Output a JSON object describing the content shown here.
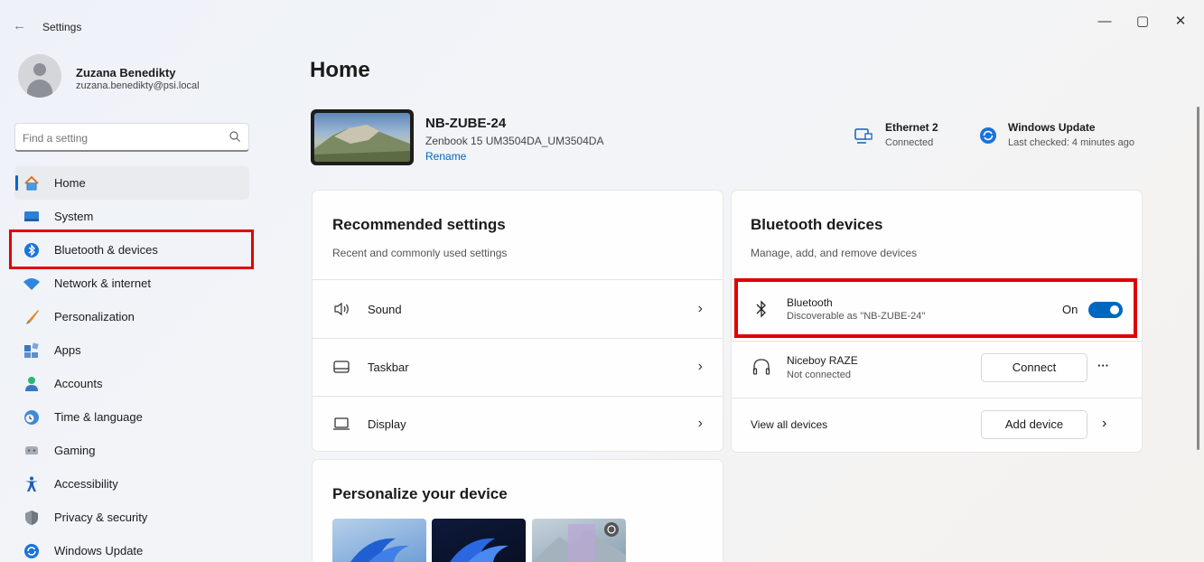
{
  "window": {
    "title": "Settings",
    "back_glyph": "←",
    "minimize_glyph": "—",
    "maximize_glyph": "▢",
    "close_glyph": "✕"
  },
  "profile": {
    "name": "Zuzana Benedikty",
    "email": "zuzana.benedikty@psi.local"
  },
  "search": {
    "placeholder": "Find a setting"
  },
  "nav": {
    "items": [
      {
        "label": "Home",
        "icon": "home-icon"
      },
      {
        "label": "System",
        "icon": "system-icon"
      },
      {
        "label": "Bluetooth & devices",
        "icon": "bluetooth-icon"
      },
      {
        "label": "Network & internet",
        "icon": "wifi-icon"
      },
      {
        "label": "Personalization",
        "icon": "brush-icon"
      },
      {
        "label": "Apps",
        "icon": "apps-icon"
      },
      {
        "label": "Accounts",
        "icon": "account-icon"
      },
      {
        "label": "Time & language",
        "icon": "clock-globe-icon"
      },
      {
        "label": "Gaming",
        "icon": "gamepad-icon"
      },
      {
        "label": "Accessibility",
        "icon": "accessibility-icon"
      },
      {
        "label": "Privacy & security",
        "icon": "shield-icon"
      },
      {
        "label": "Windows Update",
        "icon": "update-icon"
      }
    ]
  },
  "main": {
    "title": "Home",
    "device": {
      "name": "NB-ZUBE-24",
      "model": "Zenbook 15 UM3504DA_UM3504DA",
      "rename": "Rename"
    },
    "status": {
      "ethernet_title": "Ethernet 2",
      "ethernet_sub": "Connected",
      "update_title": "Windows Update",
      "update_sub": "Last checked: 4 minutes ago"
    },
    "recommended": {
      "title": "Recommended settings",
      "subtitle": "Recent and commonly used settings",
      "rows": [
        {
          "label": "Sound",
          "icon": "speaker-icon"
        },
        {
          "label": "Taskbar",
          "icon": "taskbar-icon"
        },
        {
          "label": "Display",
          "icon": "display-icon"
        }
      ],
      "chevron": "›"
    },
    "bluetooth": {
      "title": "Bluetooth devices",
      "subtitle": "Manage, add, and remove devices",
      "bt_label": "Bluetooth",
      "bt_sub": "Discoverable as \"NB-ZUBE-24\"",
      "bt_state": "On",
      "device_name": "Niceboy RAZE",
      "device_sub": "Not connected",
      "connect": "Connect",
      "more": "···",
      "view_all": "View all devices",
      "add_device": "Add device",
      "chevron": "›"
    },
    "personalize": {
      "title": "Personalize your device"
    }
  },
  "colors": {
    "accent": "#0067c0",
    "highlight": "#e00000"
  }
}
